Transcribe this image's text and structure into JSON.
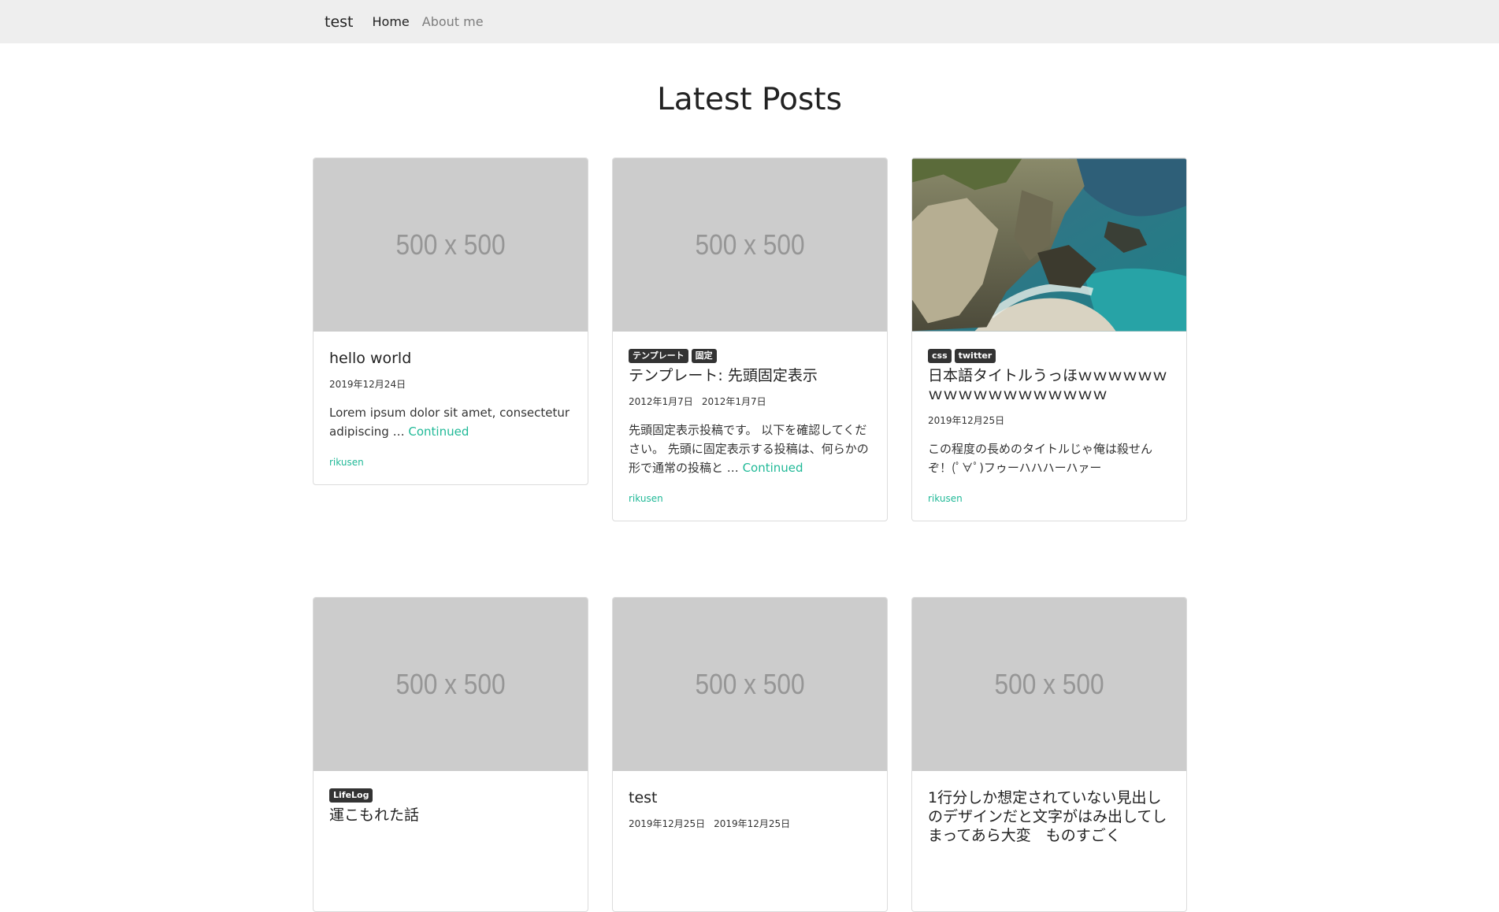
{
  "navbar": {
    "brand": "test",
    "links": [
      "Home",
      "About me"
    ]
  },
  "page": {
    "title": "Latest Posts"
  },
  "placeholder_label": "500 x 500",
  "continued_label": "Continued",
  "posts": [
    {
      "tags": [],
      "title": "hello world",
      "dates": [
        "2019年12月24日"
      ],
      "excerpt": "Lorem ipsum dolor sit amet, consectetur adipiscing …",
      "author": "rikusen",
      "thumbnail": "placeholder"
    },
    {
      "tags": [
        "テンプレート",
        "固定"
      ],
      "title": "テンプレート: 先頭固定表示",
      "dates": [
        "2012年1月7日",
        "2012年1月7日"
      ],
      "excerpt": "先頭固定表示投稿です。 以下を確認してください。 先頭に固定表示する投稿は、何らかの形で通常の投稿と …",
      "author": "rikusen",
      "thumbnail": "placeholder"
    },
    {
      "tags": [
        "css",
        "twitter"
      ],
      "title": "日本語タイトルうっほｗｗｗｗｗｗｗｗｗｗｗｗｗｗｗｗｗｗ",
      "dates": [
        "2019年12月25日"
      ],
      "excerpt": "この程度の長めのタイトルじゃ俺は殺せんぞ！(ﾟ∀ﾟ)フゥーハハハーハァー",
      "author": "rikusen",
      "thumbnail": "coastal-cliff-photo"
    },
    {
      "tags": [
        "LifeLog"
      ],
      "title": "運こもれた話",
      "dates": [],
      "excerpt": "",
      "author": "",
      "thumbnail": "placeholder"
    },
    {
      "tags": [],
      "title": "test",
      "dates": [
        "2019年12月25日",
        "2019年12月25日"
      ],
      "excerpt": "",
      "author": "",
      "thumbnail": "placeholder"
    },
    {
      "tags": [],
      "title": "1行分しか想定されていない見出しのデザインだと文字がはみ出してしまってあら大変　ものすごく",
      "dates": [],
      "excerpt": "",
      "author": "",
      "thumbnail": "placeholder"
    }
  ]
}
